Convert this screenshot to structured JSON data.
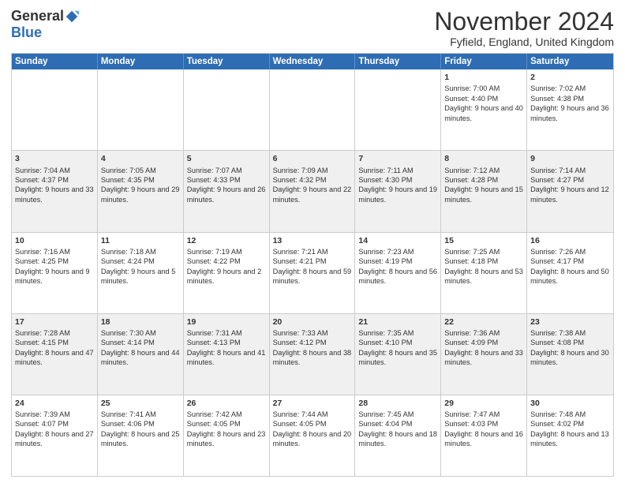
{
  "logo": {
    "general": "General",
    "blue": "Blue"
  },
  "title": "November 2024",
  "location": "Fyfield, England, United Kingdom",
  "days": [
    "Sunday",
    "Monday",
    "Tuesday",
    "Wednesday",
    "Thursday",
    "Friday",
    "Saturday"
  ],
  "weeks": [
    [
      {
        "day": "",
        "info": ""
      },
      {
        "day": "",
        "info": ""
      },
      {
        "day": "",
        "info": ""
      },
      {
        "day": "",
        "info": ""
      },
      {
        "day": "",
        "info": ""
      },
      {
        "day": "1",
        "info": "Sunrise: 7:00 AM\nSunset: 4:40 PM\nDaylight: 9 hours and 40 minutes."
      },
      {
        "day": "2",
        "info": "Sunrise: 7:02 AM\nSunset: 4:38 PM\nDaylight: 9 hours and 36 minutes."
      }
    ],
    [
      {
        "day": "3",
        "info": "Sunrise: 7:04 AM\nSunset: 4:37 PM\nDaylight: 9 hours and 33 minutes."
      },
      {
        "day": "4",
        "info": "Sunrise: 7:05 AM\nSunset: 4:35 PM\nDaylight: 9 hours and 29 minutes."
      },
      {
        "day": "5",
        "info": "Sunrise: 7:07 AM\nSunset: 4:33 PM\nDaylight: 9 hours and 26 minutes."
      },
      {
        "day": "6",
        "info": "Sunrise: 7:09 AM\nSunset: 4:32 PM\nDaylight: 9 hours and 22 minutes."
      },
      {
        "day": "7",
        "info": "Sunrise: 7:11 AM\nSunset: 4:30 PM\nDaylight: 9 hours and 19 minutes."
      },
      {
        "day": "8",
        "info": "Sunrise: 7:12 AM\nSunset: 4:28 PM\nDaylight: 9 hours and 15 minutes."
      },
      {
        "day": "9",
        "info": "Sunrise: 7:14 AM\nSunset: 4:27 PM\nDaylight: 9 hours and 12 minutes."
      }
    ],
    [
      {
        "day": "10",
        "info": "Sunrise: 7:16 AM\nSunset: 4:25 PM\nDaylight: 9 hours and 9 minutes."
      },
      {
        "day": "11",
        "info": "Sunrise: 7:18 AM\nSunset: 4:24 PM\nDaylight: 9 hours and 5 minutes."
      },
      {
        "day": "12",
        "info": "Sunrise: 7:19 AM\nSunset: 4:22 PM\nDaylight: 9 hours and 2 minutes."
      },
      {
        "day": "13",
        "info": "Sunrise: 7:21 AM\nSunset: 4:21 PM\nDaylight: 8 hours and 59 minutes."
      },
      {
        "day": "14",
        "info": "Sunrise: 7:23 AM\nSunset: 4:19 PM\nDaylight: 8 hours and 56 minutes."
      },
      {
        "day": "15",
        "info": "Sunrise: 7:25 AM\nSunset: 4:18 PM\nDaylight: 8 hours and 53 minutes."
      },
      {
        "day": "16",
        "info": "Sunrise: 7:26 AM\nSunset: 4:17 PM\nDaylight: 8 hours and 50 minutes."
      }
    ],
    [
      {
        "day": "17",
        "info": "Sunrise: 7:28 AM\nSunset: 4:15 PM\nDaylight: 8 hours and 47 minutes."
      },
      {
        "day": "18",
        "info": "Sunrise: 7:30 AM\nSunset: 4:14 PM\nDaylight: 8 hours and 44 minutes."
      },
      {
        "day": "19",
        "info": "Sunrise: 7:31 AM\nSunset: 4:13 PM\nDaylight: 8 hours and 41 minutes."
      },
      {
        "day": "20",
        "info": "Sunrise: 7:33 AM\nSunset: 4:12 PM\nDaylight: 8 hours and 38 minutes."
      },
      {
        "day": "21",
        "info": "Sunrise: 7:35 AM\nSunset: 4:10 PM\nDaylight: 8 hours and 35 minutes."
      },
      {
        "day": "22",
        "info": "Sunrise: 7:36 AM\nSunset: 4:09 PM\nDaylight: 8 hours and 33 minutes."
      },
      {
        "day": "23",
        "info": "Sunrise: 7:38 AM\nSunset: 4:08 PM\nDaylight: 8 hours and 30 minutes."
      }
    ],
    [
      {
        "day": "24",
        "info": "Sunrise: 7:39 AM\nSunset: 4:07 PM\nDaylight: 8 hours and 27 minutes."
      },
      {
        "day": "25",
        "info": "Sunrise: 7:41 AM\nSunset: 4:06 PM\nDaylight: 8 hours and 25 minutes."
      },
      {
        "day": "26",
        "info": "Sunrise: 7:42 AM\nSunset: 4:05 PM\nDaylight: 8 hours and 23 minutes."
      },
      {
        "day": "27",
        "info": "Sunrise: 7:44 AM\nSunset: 4:05 PM\nDaylight: 8 hours and 20 minutes."
      },
      {
        "day": "28",
        "info": "Sunrise: 7:45 AM\nSunset: 4:04 PM\nDaylight: 8 hours and 18 minutes."
      },
      {
        "day": "29",
        "info": "Sunrise: 7:47 AM\nSunset: 4:03 PM\nDaylight: 8 hours and 16 minutes."
      },
      {
        "day": "30",
        "info": "Sunrise: 7:48 AM\nSunset: 4:02 PM\nDaylight: 8 hours and 13 minutes."
      }
    ]
  ]
}
